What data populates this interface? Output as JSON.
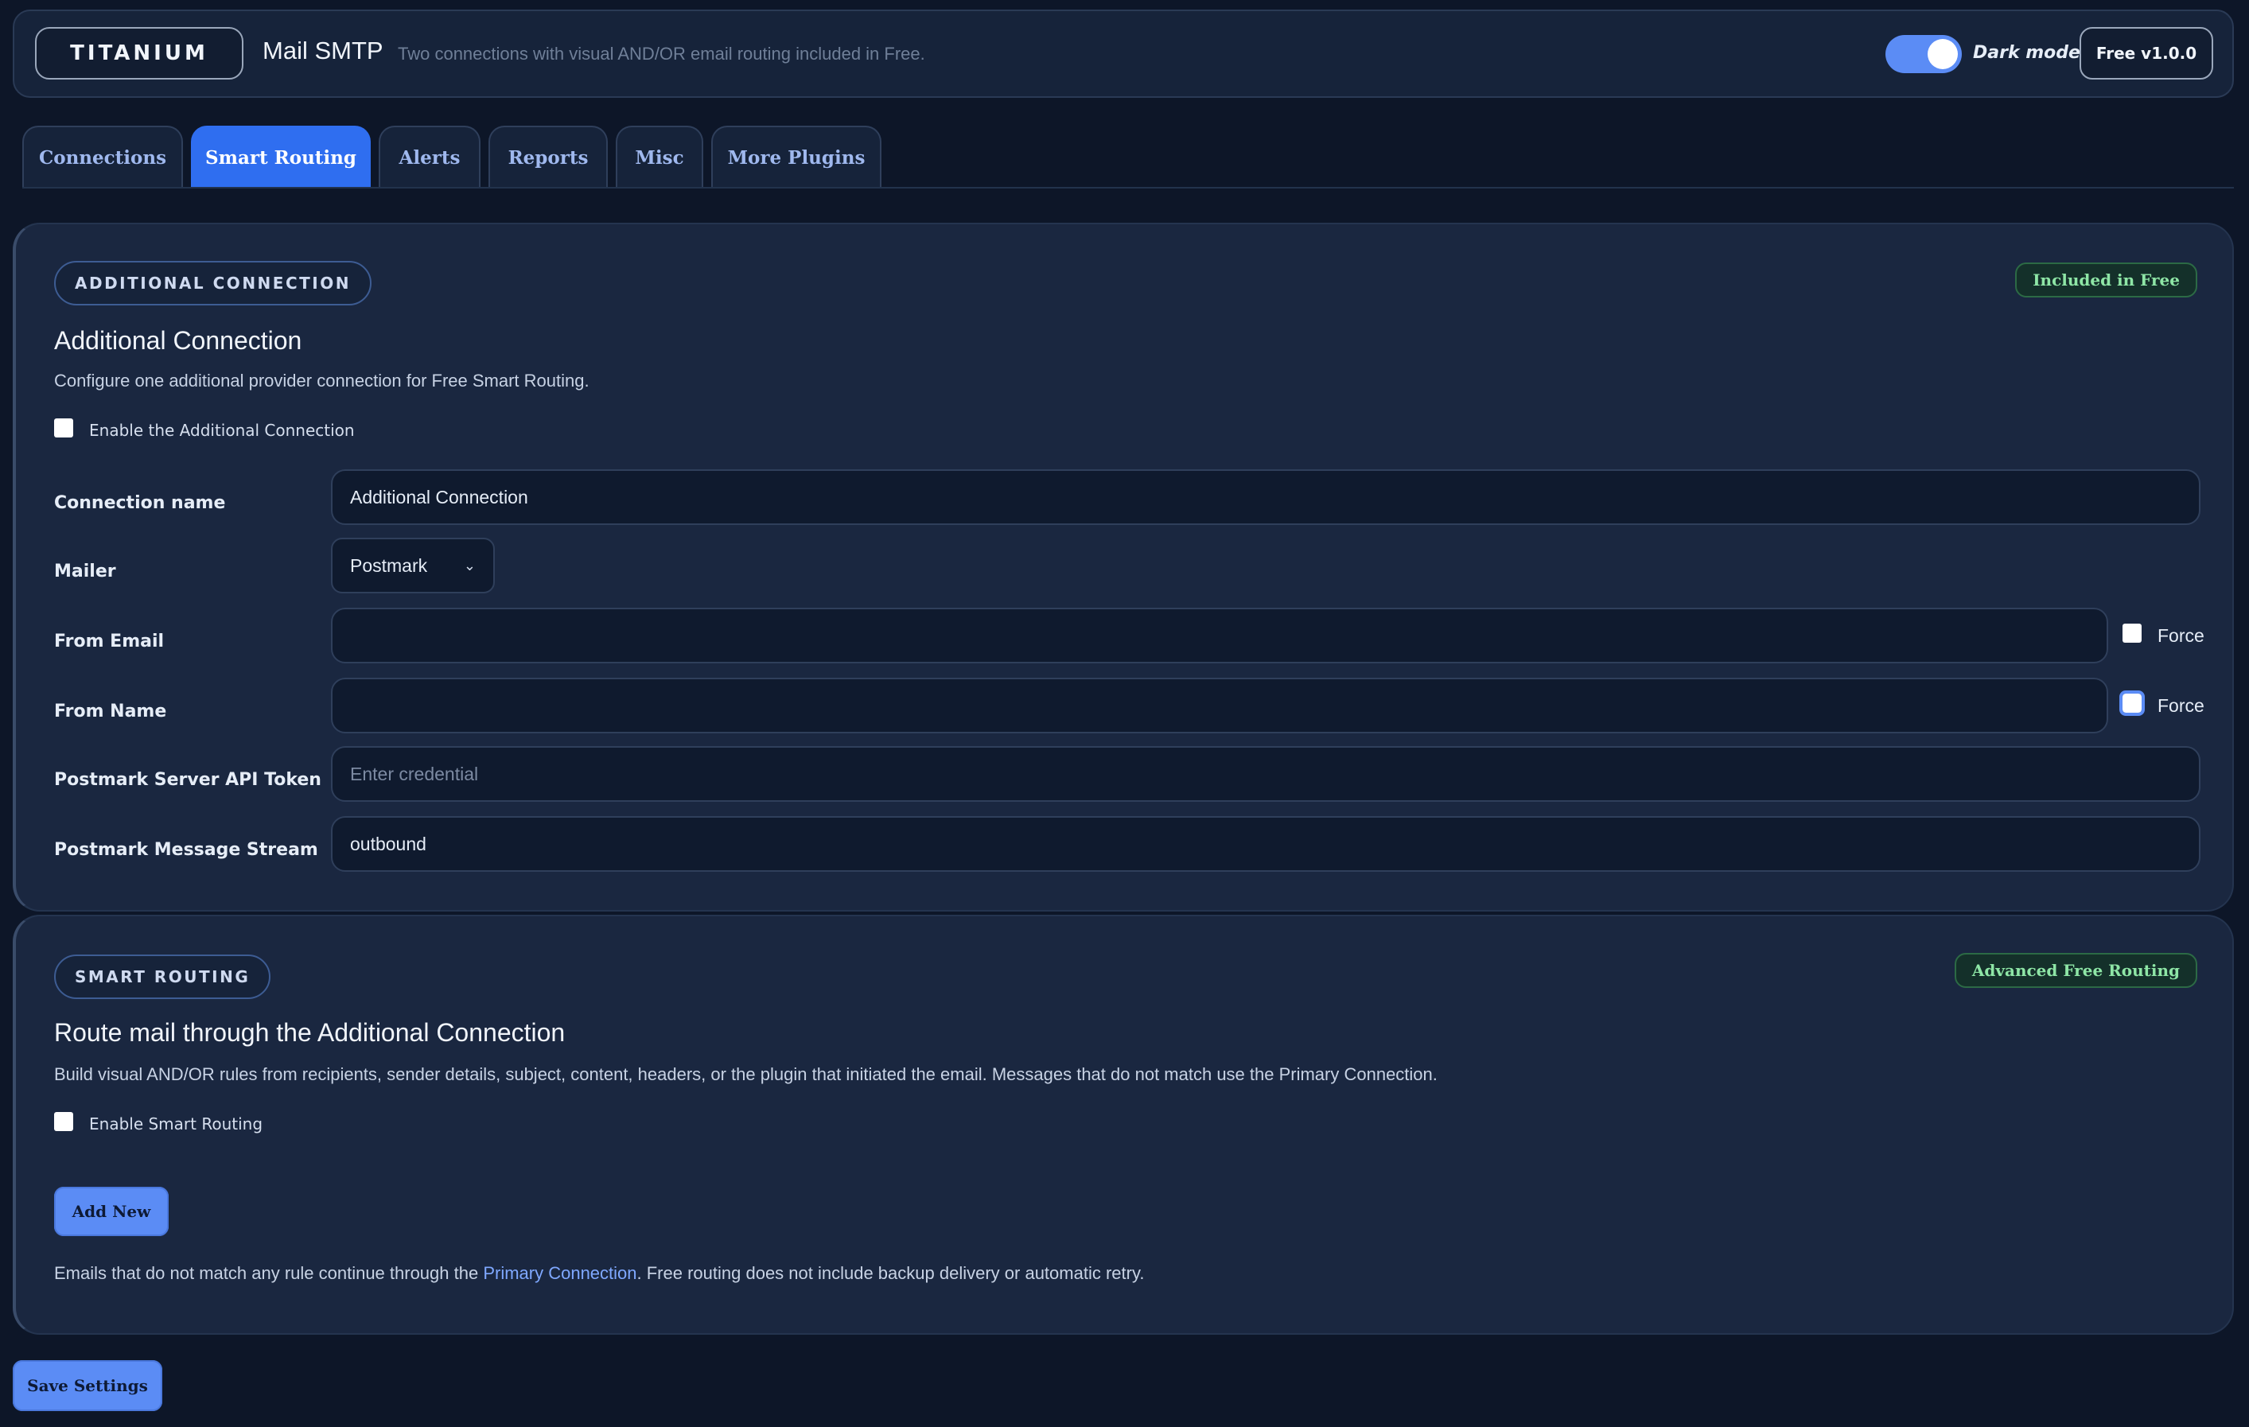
{
  "header": {
    "brand": "TITANIUM",
    "title": "Mail SMTP",
    "subtitle": "Two connections with visual AND/OR email routing included in Free.",
    "dark_mode_label": "Dark mode",
    "dark_mode_on": true,
    "version": "Free v1.0.0"
  },
  "tabs": [
    {
      "label": "Connections",
      "active": false
    },
    {
      "label": "Smart Routing",
      "active": true
    },
    {
      "label": "Alerts",
      "active": false
    },
    {
      "label": "Reports",
      "active": false
    },
    {
      "label": "Misc",
      "active": false
    },
    {
      "label": "More Plugins",
      "active": false
    }
  ],
  "additional": {
    "pill": "ADDITIONAL CONNECTION",
    "badge": "Included in Free",
    "title": "Additional Connection",
    "description": "Configure one additional provider connection for Free Smart Routing.",
    "enable_label": "Enable the Additional Connection",
    "enable_checked": false,
    "fields": {
      "connection_name": {
        "label": "Connection name",
        "value": "Additional Connection"
      },
      "mailer": {
        "label": "Mailer",
        "value": "Postmark"
      },
      "from_email": {
        "label": "From Email",
        "value": "",
        "force_label": "Force"
      },
      "from_name": {
        "label": "From Name",
        "value": "",
        "force_label": "Force"
      },
      "api_token": {
        "label": "Postmark Server API Token",
        "placeholder": "Enter credential"
      },
      "message_stream": {
        "label": "Postmark Message Stream",
        "value": "outbound"
      }
    }
  },
  "routing": {
    "pill": "SMART ROUTING",
    "badge": "Advanced Free Routing",
    "title": "Route mail through the Additional Connection",
    "description": "Build visual AND/OR rules from recipients, sender details, subject, content, headers, or the plugin that initiated the email. Messages that do not match use the Primary Connection.",
    "enable_label": "Enable Smart Routing",
    "enable_checked": false,
    "add_button": "Add New",
    "note_before": "Emails that do not match any rule continue through the ",
    "note_link": "Primary Connection",
    "note_after": ". Free routing does not include backup delivery or automatic retry."
  },
  "save_button": "Save Settings",
  "colors": {
    "background": "#0d1628",
    "panel": "#1a2740",
    "accent": "#2f6ef0",
    "button": "#5b8cf5",
    "badge_text": "#8ee6a6",
    "link": "#7fa8ff"
  }
}
